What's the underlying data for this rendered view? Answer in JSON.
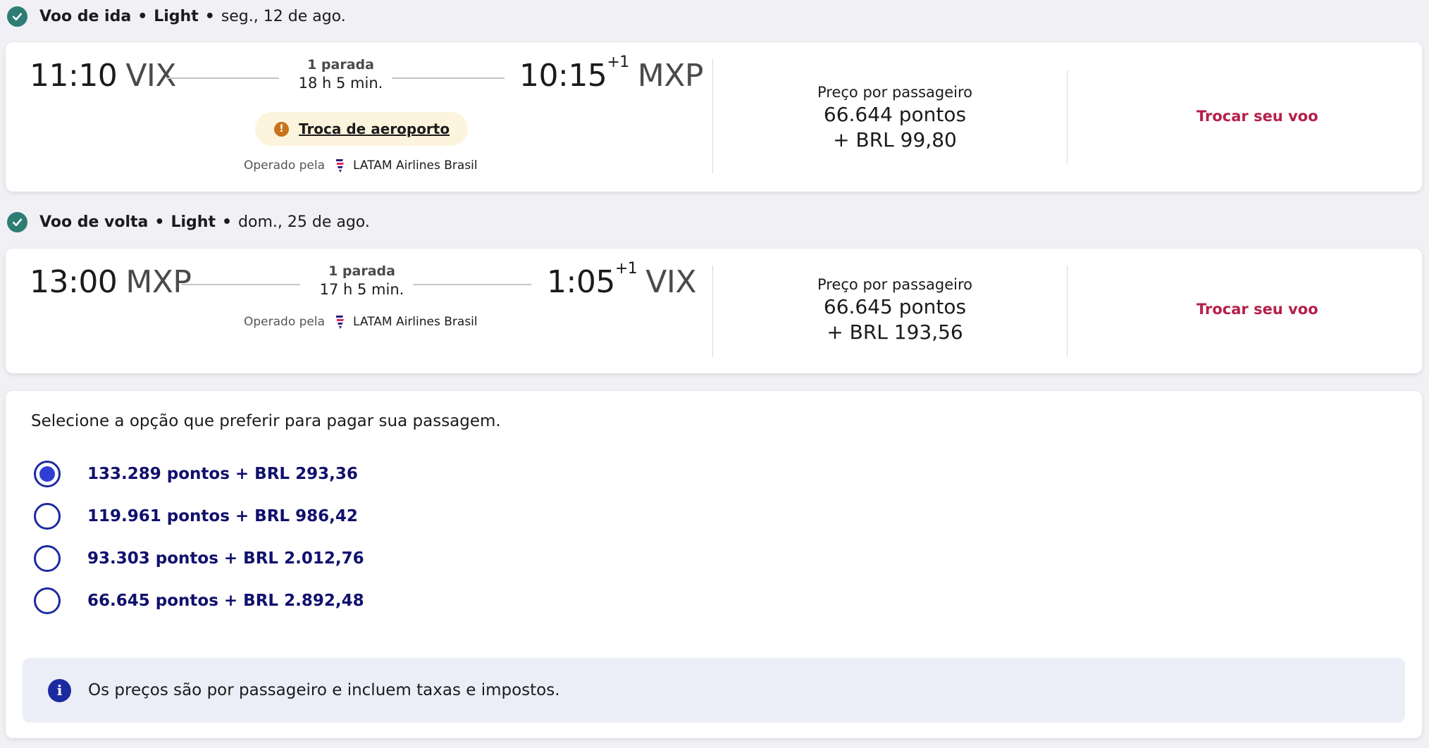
{
  "outbound": {
    "header": {
      "label": "Voo de ida",
      "fare": "Light",
      "date": "seg., 12 de ago."
    },
    "departure_time": "11:10",
    "departure_airport": "VIX",
    "stops": "1 parada",
    "duration": "18 h 5 min.",
    "arrival_time": "10:15",
    "arrival_day_offset": "+1",
    "arrival_airport": "MXP",
    "airport_change_label": "Troca de aeroporto",
    "operated_by_label": "Operado pela",
    "airline": "LATAM Airlines Brasil",
    "price_label": "Preço por passageiro",
    "price_points": "66.644 pontos",
    "price_money": "+ BRL 99,80",
    "change_flight_label": "Trocar seu voo"
  },
  "return": {
    "header": {
      "label": "Voo de volta",
      "fare": "Light",
      "date": "dom., 25 de ago."
    },
    "departure_time": "13:00",
    "departure_airport": "MXP",
    "stops": "1 parada",
    "duration": "17 h 5 min.",
    "arrival_time": "1:05",
    "arrival_day_offset": "+1",
    "arrival_airport": "VIX",
    "operated_by_label": "Operado pela",
    "airline": "LATAM Airlines Brasil",
    "price_label": "Preço por passageiro",
    "price_points": "66.645 pontos",
    "price_money": "+ BRL 193,56",
    "change_flight_label": "Trocar seu voo"
  },
  "payment": {
    "title": "Selecione a opção que preferir para pagar sua passagem.",
    "options": [
      {
        "label": "133.289 pontos + BRL 293,36",
        "selected": true
      },
      {
        "label": "119.961 pontos + BRL 986,42",
        "selected": false
      },
      {
        "label": "93.303 pontos + BRL 2.012,76",
        "selected": false
      },
      {
        "label": "66.645 pontos + BRL 2.892,48",
        "selected": false
      }
    ],
    "info_text": "Os preços são por passageiro e incluem taxas e impostos."
  },
  "icons": {
    "section_check": "check-circle-icon",
    "warning": "warning-icon",
    "airline_logo": "latam-logo-icon",
    "info": "info-icon"
  },
  "colors": {
    "accent_check": "#2e7d75",
    "change_button": "#b51f4a",
    "option_text": "#10106e",
    "radio": "#1c2aa0",
    "warning_bg": "#fdf4dd"
  }
}
